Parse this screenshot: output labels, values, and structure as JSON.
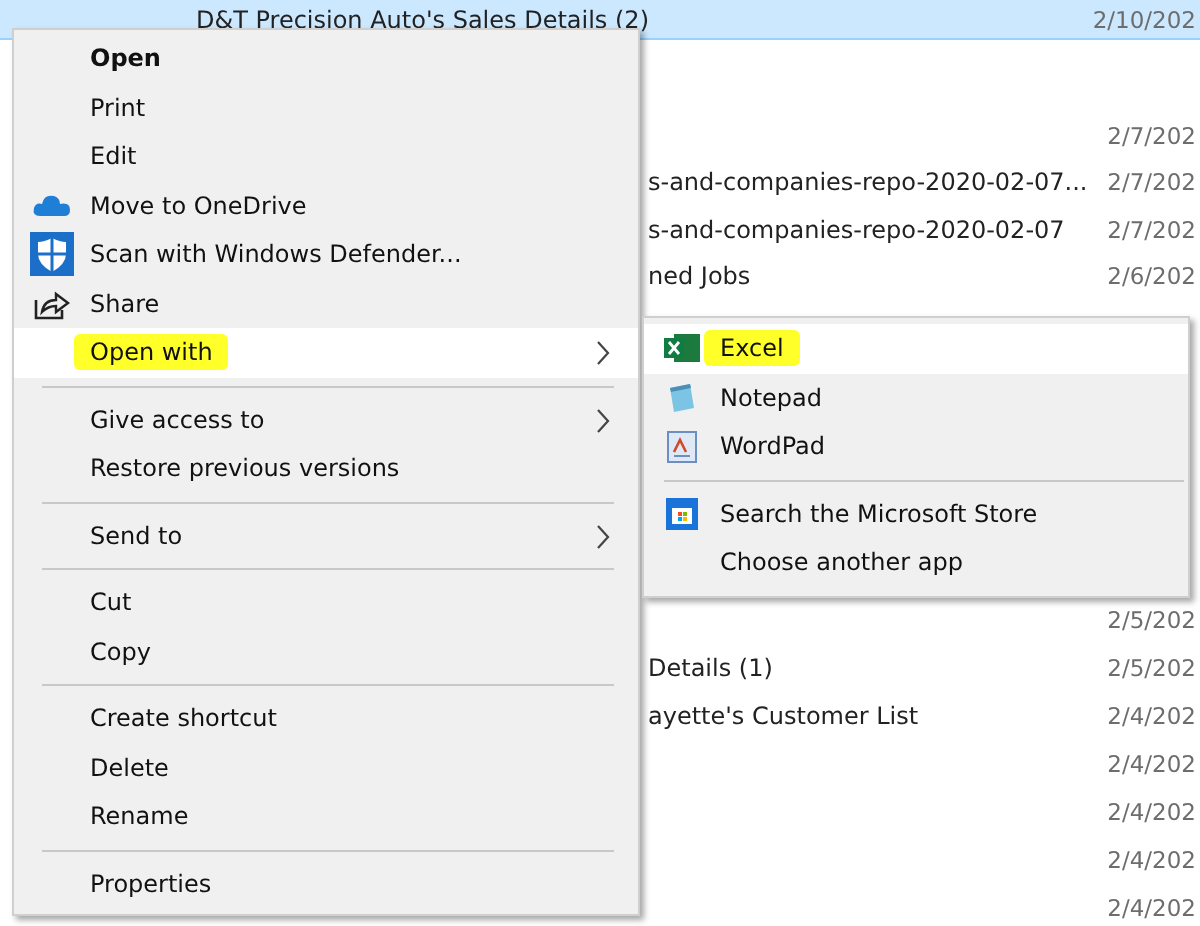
{
  "files": [
    {
      "name": "D&T Precision Auto's Sales Details (2)",
      "date": "2/10/202",
      "selected": true
    },
    {
      "date": "2/7/202",
      "selected": false
    },
    {
      "name": "s-and-companies-repo-2020-02-07...",
      "date": "2/7/202",
      "selected": false
    },
    {
      "name": "s-and-companies-repo-2020-02-07",
      "date": "2/7/202",
      "selected": false
    },
    {
      "name": "ned Jobs",
      "date": "2/6/202",
      "selected": false
    }
  ],
  "more_files": [
    {
      "date": "2/5/202",
      "selected": false
    },
    {
      "name": "Details (1)",
      "date": "2/5/202",
      "selected": false
    },
    {
      "name": "ayette's Customer List",
      "date": "2/4/202",
      "selected": false
    },
    {
      "date": "2/4/202",
      "selected": false
    },
    {
      "date": "2/4/202",
      "selected": false
    },
    {
      "date": "2/4/202",
      "selected": false
    },
    {
      "date": "2/4/202",
      "selected": false
    }
  ],
  "context_menu": {
    "items": [
      {
        "kind": "item",
        "label": "Open",
        "default": true,
        "submenu": false,
        "selected": false,
        "highlighted": false
      },
      {
        "kind": "item",
        "label": "Print",
        "default": false,
        "submenu": false,
        "selected": false,
        "highlighted": false
      },
      {
        "kind": "item",
        "label": "Edit",
        "default": false,
        "submenu": false,
        "selected": false,
        "highlighted": false
      },
      {
        "kind": "item",
        "label": "Move to OneDrive",
        "default": false,
        "submenu": false,
        "selected": false,
        "highlighted": false
      },
      {
        "kind": "item",
        "label": "Scan with Windows Defender...",
        "default": false,
        "submenu": false,
        "selected": false,
        "highlighted": false
      },
      {
        "kind": "item",
        "label": "Share",
        "default": false,
        "submenu": false,
        "selected": false,
        "highlighted": false
      },
      {
        "kind": "item",
        "label": "Open with",
        "default": false,
        "submenu": true,
        "selected": true,
        "highlighted": true
      },
      {
        "kind": "separator"
      },
      {
        "kind": "item",
        "label": "Give access to",
        "default": false,
        "submenu": true,
        "selected": false,
        "highlighted": false
      },
      {
        "kind": "item",
        "label": "Restore previous versions",
        "default": false,
        "submenu": false,
        "selected": false,
        "highlighted": false
      },
      {
        "kind": "separator"
      },
      {
        "kind": "item",
        "label": "Send to",
        "default": false,
        "submenu": true,
        "selected": false,
        "highlighted": false
      },
      {
        "kind": "separator"
      },
      {
        "kind": "item",
        "label": "Cut",
        "default": false,
        "submenu": false,
        "selected": false,
        "highlighted": false
      },
      {
        "kind": "item",
        "label": "Copy",
        "default": false,
        "submenu": false,
        "selected": false,
        "highlighted": false
      },
      {
        "kind": "separator"
      },
      {
        "kind": "item",
        "label": "Create shortcut",
        "default": false,
        "submenu": false,
        "selected": false,
        "highlighted": false
      },
      {
        "kind": "item",
        "label": "Delete",
        "default": false,
        "submenu": false,
        "selected": false,
        "highlighted": false
      },
      {
        "kind": "item",
        "label": "Rename",
        "default": false,
        "submenu": false,
        "selected": false,
        "highlighted": false
      },
      {
        "kind": "separator"
      },
      {
        "kind": "item",
        "label": "Properties",
        "default": false,
        "submenu": false,
        "selected": false,
        "highlighted": false
      }
    ]
  },
  "open_with_menu": {
    "items": [
      {
        "kind": "item",
        "label": "Excel",
        "selected": true,
        "highlighted": true
      },
      {
        "kind": "item",
        "label": "Notepad",
        "selected": false,
        "highlighted": false
      },
      {
        "kind": "item",
        "label": "WordPad",
        "selected": false,
        "highlighted": false
      },
      {
        "kind": "separator"
      },
      {
        "kind": "item",
        "label": "Search the Microsoft Store",
        "selected": false,
        "highlighted": false
      },
      {
        "kind": "item",
        "label": "Choose another app",
        "selected": false,
        "highlighted": false
      }
    ]
  }
}
